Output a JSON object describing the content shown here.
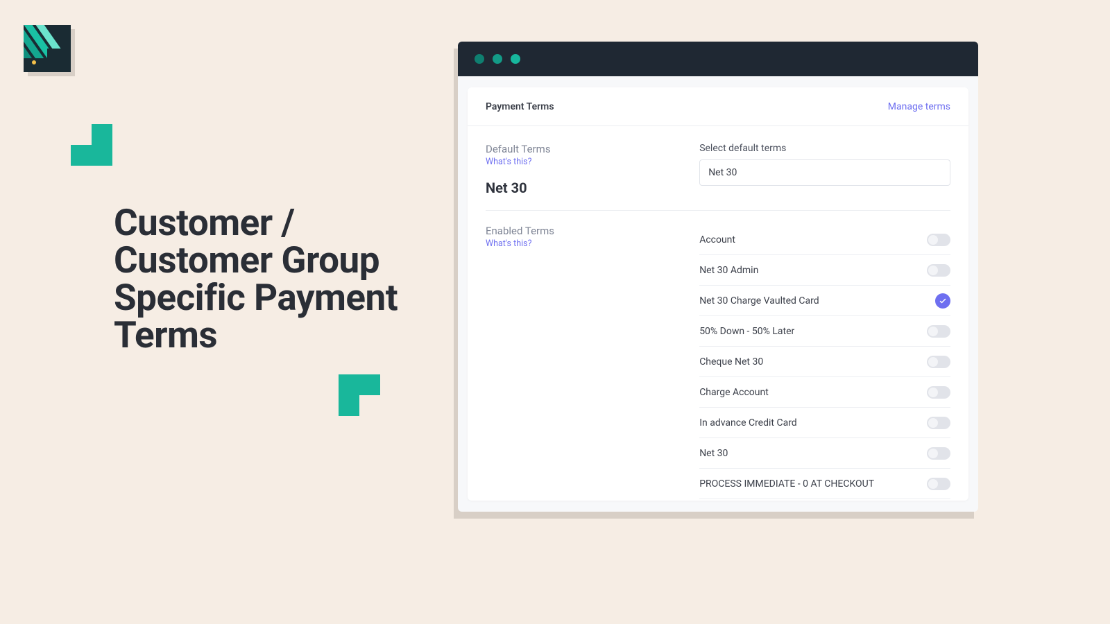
{
  "hero": {
    "title": "Customer / Customer Group Specific Payment Terms"
  },
  "card": {
    "title": "Payment Terms",
    "manage_link": "Manage terms",
    "default_terms": {
      "label": "Default Terms",
      "help": "What's this?",
      "value": "Net 30",
      "select_label": "Select default terms",
      "select_value": "Net 30"
    },
    "enabled_terms": {
      "label": "Enabled Terms",
      "help": "What's this?",
      "items": [
        {
          "label": "Account",
          "on": false
        },
        {
          "label": "Net 30 Admin",
          "on": false
        },
        {
          "label": "Net 30 Charge Vaulted Card",
          "on": true
        },
        {
          "label": "50% Down - 50% Later",
          "on": false
        },
        {
          "label": "Cheque Net 30",
          "on": false
        },
        {
          "label": "Charge Account",
          "on": false
        },
        {
          "label": "In advance Credit Card",
          "on": false
        },
        {
          "label": "Net 30",
          "on": false
        },
        {
          "label": "PROCESS IMMEDIATE - 0 AT CHECKOUT",
          "on": false
        }
      ]
    }
  }
}
